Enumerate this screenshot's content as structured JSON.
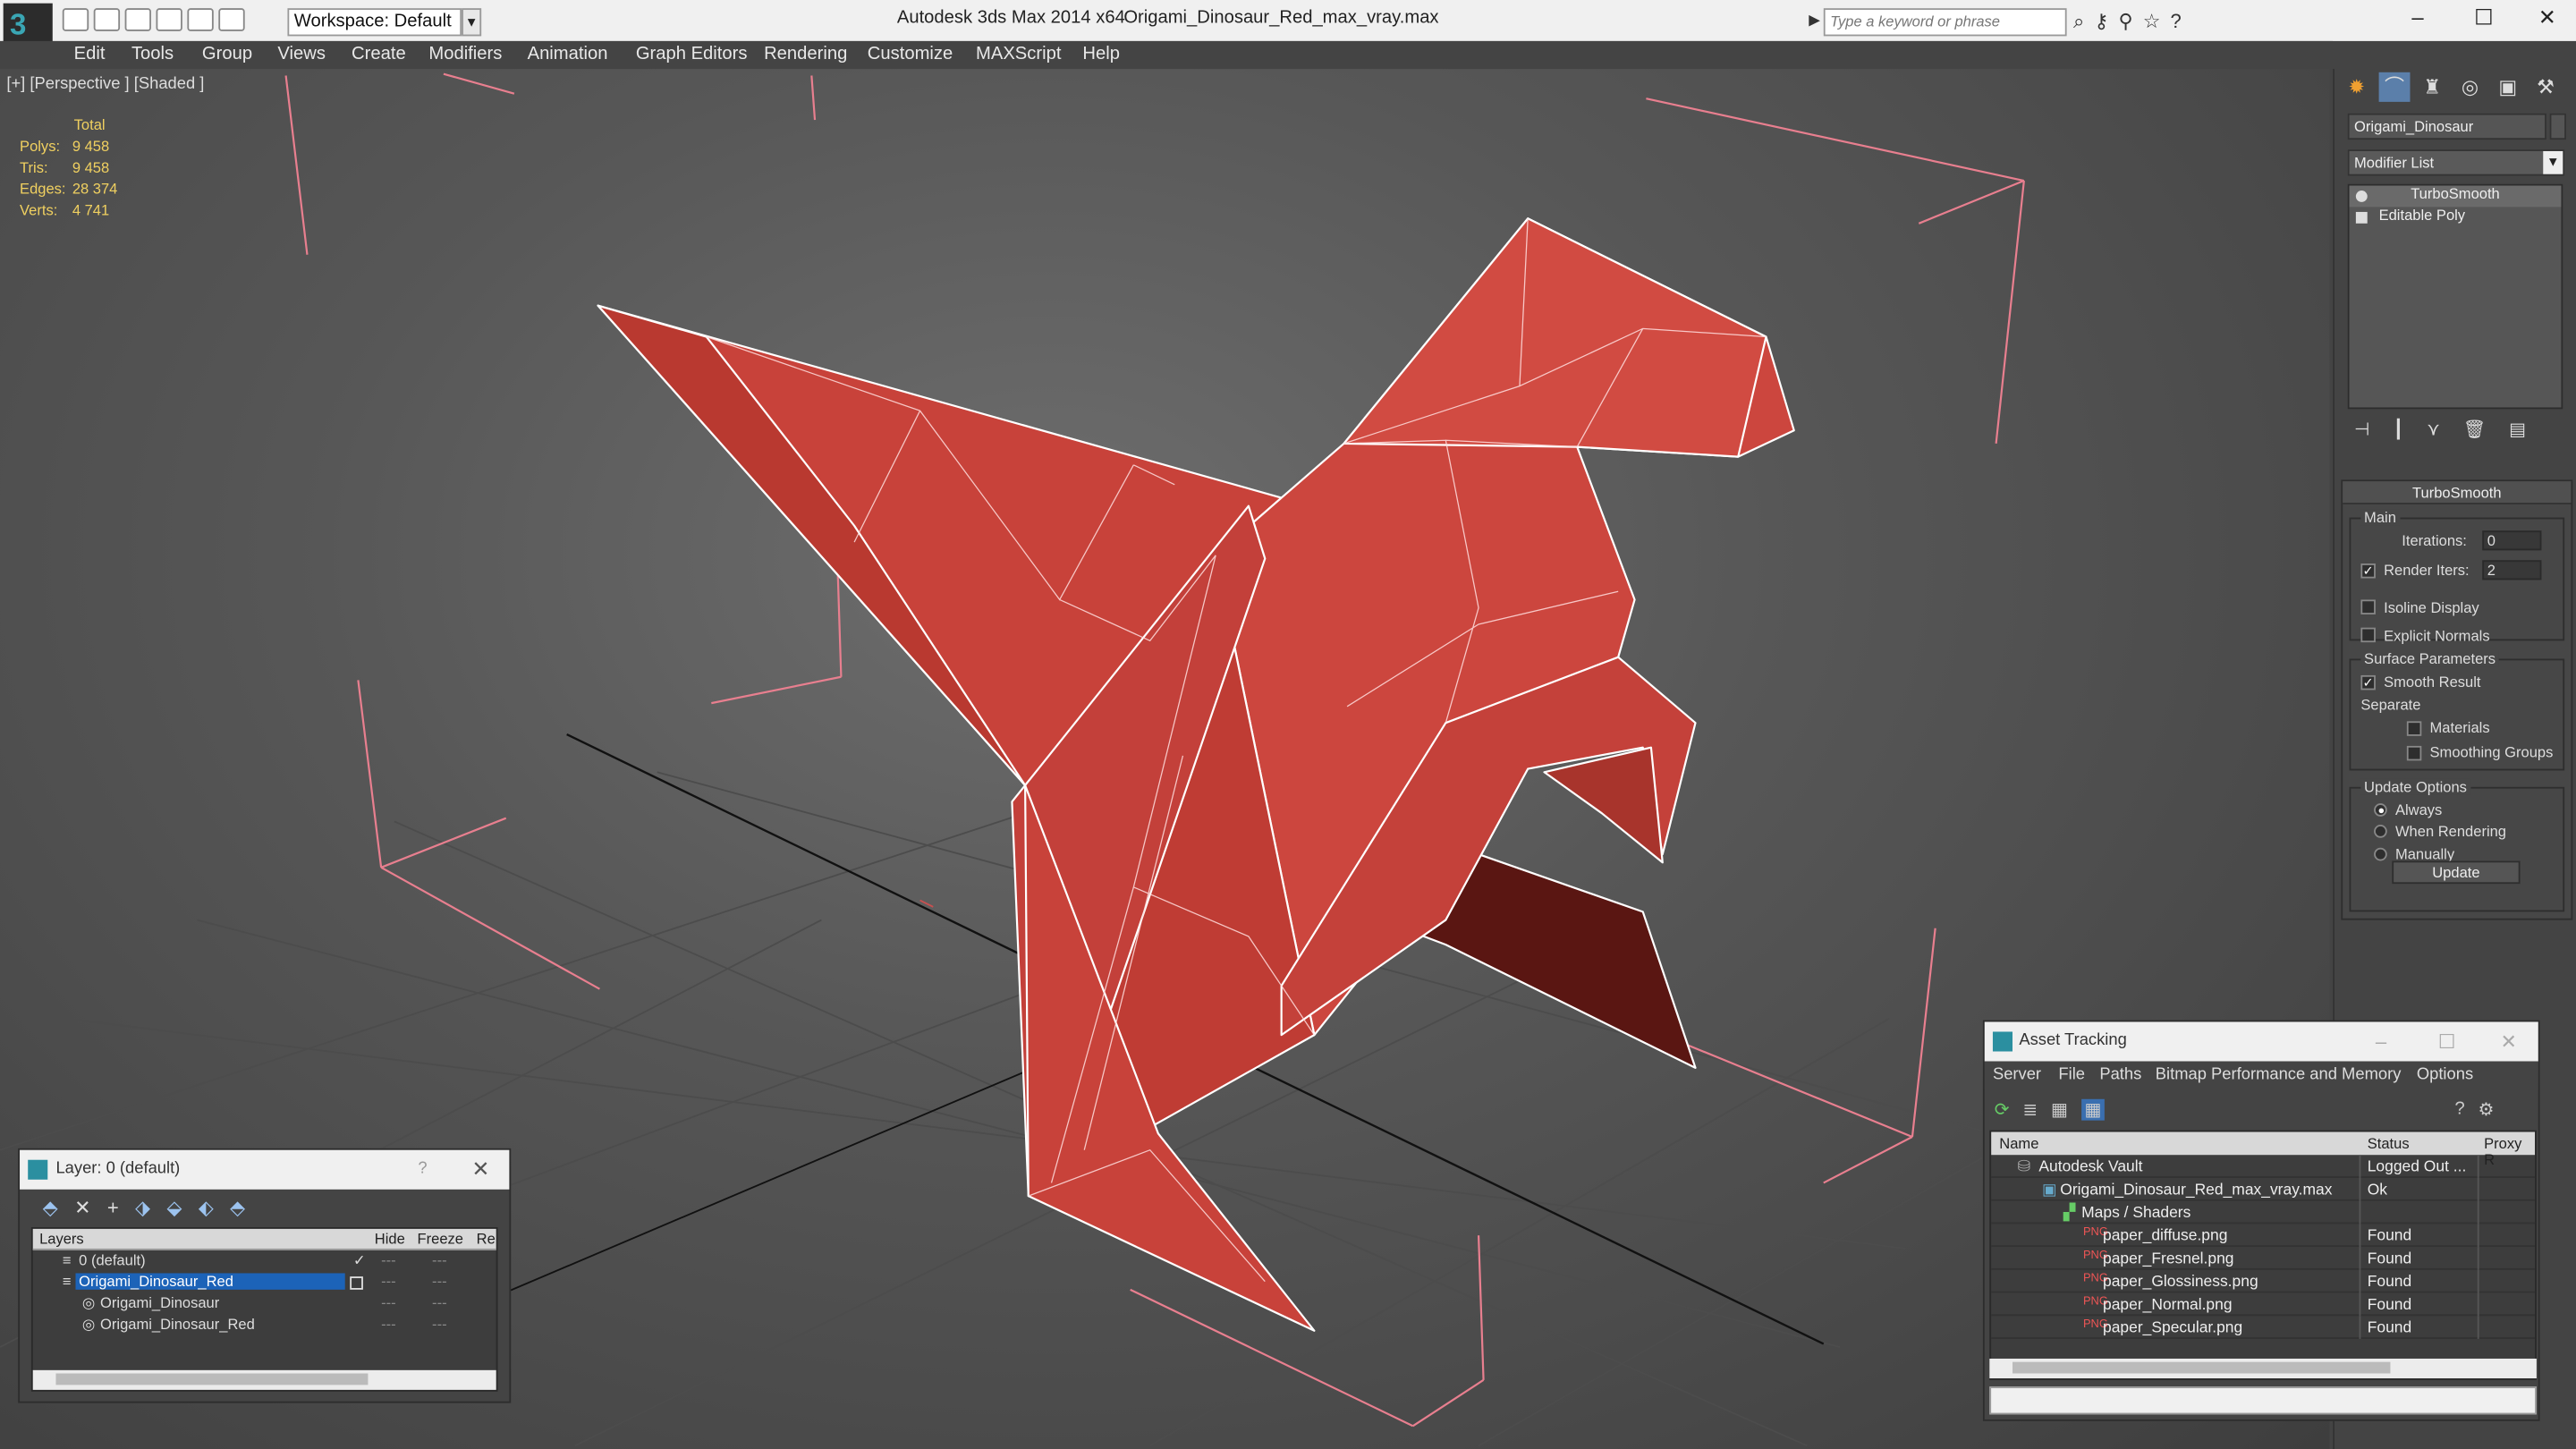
{
  "window": {
    "app_title": "Autodesk 3ds Max  2014 x64",
    "file_title": "Origami_Dinosaur_Red_max_vray.max",
    "workspace": "Workspace: Default",
    "search_placeholder": "Type a keyword or phrase"
  },
  "menu": [
    "Edit",
    "Tools",
    "Group",
    "Views",
    "Create",
    "Modifiers",
    "Animation",
    "Graph Editors",
    "Rendering",
    "Customize",
    "MAXScript",
    "Help"
  ],
  "viewport": {
    "label": "[+] [Perspective ] [Shaded ]",
    "stats": {
      "header": "Total",
      "polys_label": "Polys:",
      "polys": "9 458",
      "tris_label": "Tris:",
      "tris": "9 458",
      "edges_label": "Edges:",
      "edges": "28 374",
      "verts_label": "Verts:",
      "verts": "4 741"
    },
    "model_color": "#c8423a"
  },
  "command_panel": {
    "object_name": "Origami_Dinosaur",
    "modifier_list": "Modifier List",
    "stack": [
      "TurboSmooth",
      "Editable Poly"
    ],
    "rollout_title": "TurboSmooth",
    "main_group": "Main",
    "iterations_label": "Iterations:",
    "iterations_value": "0",
    "render_iters_label": "Render Iters:",
    "render_iters_value": "2",
    "isoline_label": "Isoline Display",
    "explicit_normals_label": "Explicit Normals",
    "surface_group": "Surface Parameters",
    "smooth_result_label": "Smooth Result",
    "separate_label": "Separate",
    "materials_label": "Materials",
    "smoothing_groups_label": "Smoothing Groups",
    "update_group": "Update Options",
    "always_label": "Always",
    "when_rendering_label": "When Rendering",
    "manually_label": "Manually",
    "update_button": "Update"
  },
  "layer_dialog": {
    "title": "Layer: 0 (default)",
    "help": "?",
    "columns": [
      "Layers",
      "Hide",
      "Freeze",
      "Re"
    ],
    "rows": [
      "0 (default)",
      "Origami_Dinosaur_Red",
      "Origami_Dinosaur",
      "Origami_Dinosaur_Red"
    ]
  },
  "asset_tracking": {
    "title": "Asset Tracking",
    "menu": [
      "Server",
      "File",
      "Paths",
      "Bitmap Performance and Memory",
      "Options"
    ],
    "columns": [
      "Name",
      "Status",
      "Proxy R"
    ],
    "rows": [
      {
        "name": "Autodesk Vault",
        "status": "Logged Out ..."
      },
      {
        "name": "Origami_Dinosaur_Red_max_vray.max",
        "status": "Ok"
      },
      {
        "name": "Maps / Shaders",
        "status": ""
      },
      {
        "name": "paper_diffuse.png",
        "status": "Found"
      },
      {
        "name": "paper_Fresnel.png",
        "status": "Found"
      },
      {
        "name": "paper_Glossiness.png",
        "status": "Found"
      },
      {
        "name": "paper_Normal.png",
        "status": "Found"
      },
      {
        "name": "paper_Specular.png",
        "status": "Found"
      }
    ]
  }
}
